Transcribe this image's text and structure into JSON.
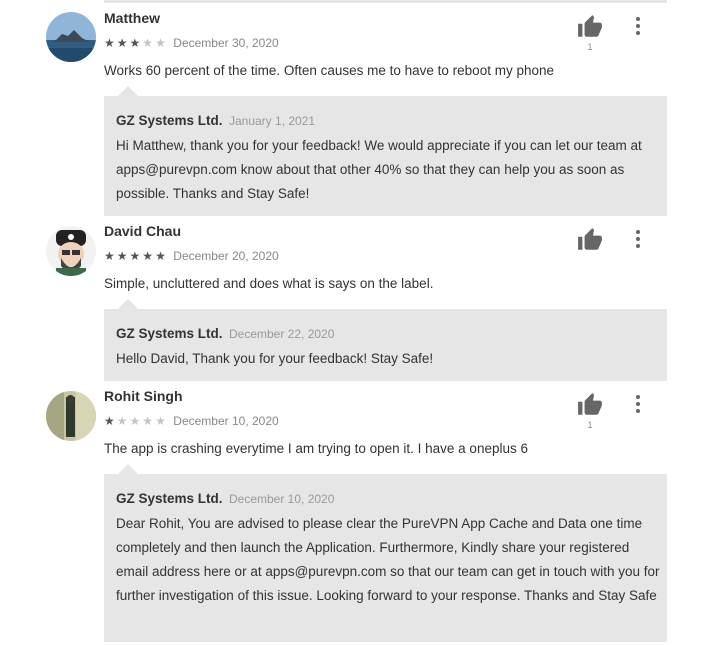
{
  "reviews": [
    {
      "author": "Matthew",
      "rating": 3,
      "date": "December 30, 2020",
      "text": "Works 60 percent of the time. Often causes me to have to reboot my phone",
      "likes": "1",
      "reply": {
        "developer": "GZ Systems Ltd.",
        "date": "January 1, 2021",
        "text": "Hi Matthew, thank you for your feedback! We would appreciate if you can let our team at apps@purevpn.com know about that other 40% so that they can help you as soon as possible. Thanks and Stay Safe!"
      }
    },
    {
      "author": "David Chau",
      "rating": 5,
      "date": "December 20, 2020",
      "text": "Simple, uncluttered and does what is says on the label.",
      "likes": "",
      "reply": {
        "developer": "GZ Systems Ltd.",
        "date": "December 22, 2020",
        "text": "Hello David, Thank you for your feedback! Stay Safe!"
      }
    },
    {
      "author": "Rohit Singh",
      "rating": 1,
      "date": "December 10, 2020",
      "text": "The app is crashing everytime I am trying to open it. I have a oneplus 6",
      "likes": "1",
      "reply": {
        "developer": "GZ Systems Ltd.",
        "date": "December 10, 2020",
        "text": "Dear Rohit, You are advised to please clear the PureVPN App Cache and Data one time completely and then launch the Application. Furthermore, Kindly share your registered email address here or at apps@purevpn.com so that our team can get in touch with you for further investigation of this issue. Looking forward to your response. Thanks and Stay Safe"
      }
    }
  ],
  "icons": {
    "like": "thumbs-up-icon",
    "more": "more-vert-icon",
    "star": "star-icon"
  },
  "colors": {
    "reply_background": "#e6e6e6",
    "star_filled": "#555555",
    "star_empty": "#c4c4c4"
  }
}
